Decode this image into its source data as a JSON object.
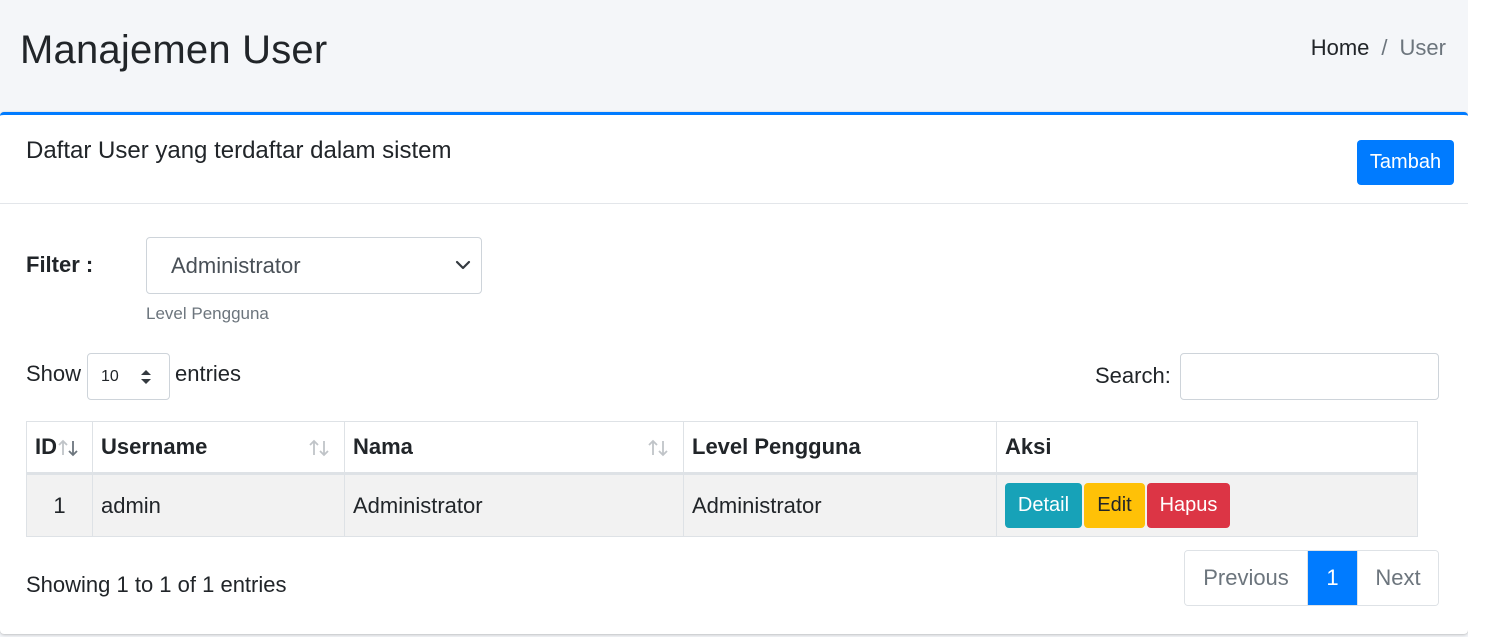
{
  "header": {
    "title": "Manajemen User",
    "breadcrumb": {
      "home": "Home",
      "separator": "/",
      "current": "User"
    }
  },
  "card": {
    "title": "Daftar User yang terdaftar dalam sistem",
    "add_button": "Tambah"
  },
  "filter": {
    "label": "Filter :",
    "selected": "Administrator",
    "help": "Level Pengguna"
  },
  "datatable": {
    "show_label": "Show",
    "length_value": "10",
    "entries_label": "entries",
    "search_label": "Search:",
    "search_value": "",
    "columns": [
      "ID",
      "Username",
      "Nama",
      "Level Pengguna",
      "Aksi"
    ],
    "rows": [
      {
        "id": "1",
        "username": "admin",
        "nama": "Administrator",
        "level": "Administrator",
        "actions": {
          "detail": "Detail",
          "edit": "Edit",
          "hapus": "Hapus"
        }
      }
    ],
    "info": "Showing 1 to 1 of 1 entries",
    "pagination": {
      "previous": "Previous",
      "current": "1",
      "next": "Next"
    }
  },
  "colors": {
    "primary": "#007bff",
    "info": "#17a2b8",
    "warning": "#ffc107",
    "danger": "#dc3545"
  },
  "icons": {
    "filter_select": "chevron-down-icon",
    "length_select": "up-down-arrows-icon",
    "sort": "sort-arrows-icon"
  }
}
